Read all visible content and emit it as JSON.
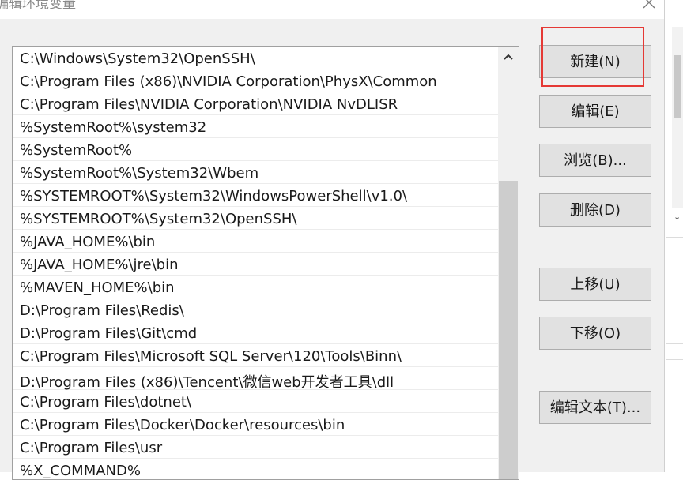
{
  "window": {
    "title": "编辑环境变量"
  },
  "path_list": {
    "items": [
      "C:\\Windows\\System32\\OpenSSH\\",
      "C:\\Program Files (x86)\\NVIDIA Corporation\\PhysX\\Common",
      "C:\\Program Files\\NVIDIA Corporation\\NVIDIA NvDLISR",
      "%SystemRoot%\\system32",
      "%SystemRoot%",
      "%SystemRoot%\\System32\\Wbem",
      "%SYSTEMROOT%\\System32\\WindowsPowerShell\\v1.0\\",
      "%SYSTEMROOT%\\System32\\OpenSSH\\",
      "%JAVA_HOME%\\bin",
      "%JAVA_HOME%\\jre\\bin",
      "%MAVEN_HOME%\\bin",
      "D:\\Program Files\\Redis\\",
      "D:\\Program Files\\Git\\cmd",
      "C:\\Program Files\\Microsoft SQL Server\\120\\Tools\\Binn\\",
      "D:\\Program Files (x86)\\Tencent\\微信web开发者工具\\dll",
      "C:\\Program Files\\dotnet\\",
      "C:\\Program Files\\Docker\\Docker\\resources\\bin",
      "C:\\Program Files\\usr",
      "%X_COMMAND%"
    ]
  },
  "buttons": {
    "new": "新建(N)",
    "edit": "编辑(E)",
    "browse": "浏览(B)...",
    "delete": "删除(D)",
    "move_up": "上移(U)",
    "move_down": "下移(O)",
    "edit_text": "编辑文本(T)..."
  },
  "icons": {
    "close": "close-icon",
    "scroll_up": "chevron-up-icon",
    "edge_scroll_down": "chevron-down-icon"
  },
  "colors": {
    "highlight": "#e53935",
    "dialog_bg": "#f0f0f0",
    "button_bg": "#e1e1e1"
  }
}
